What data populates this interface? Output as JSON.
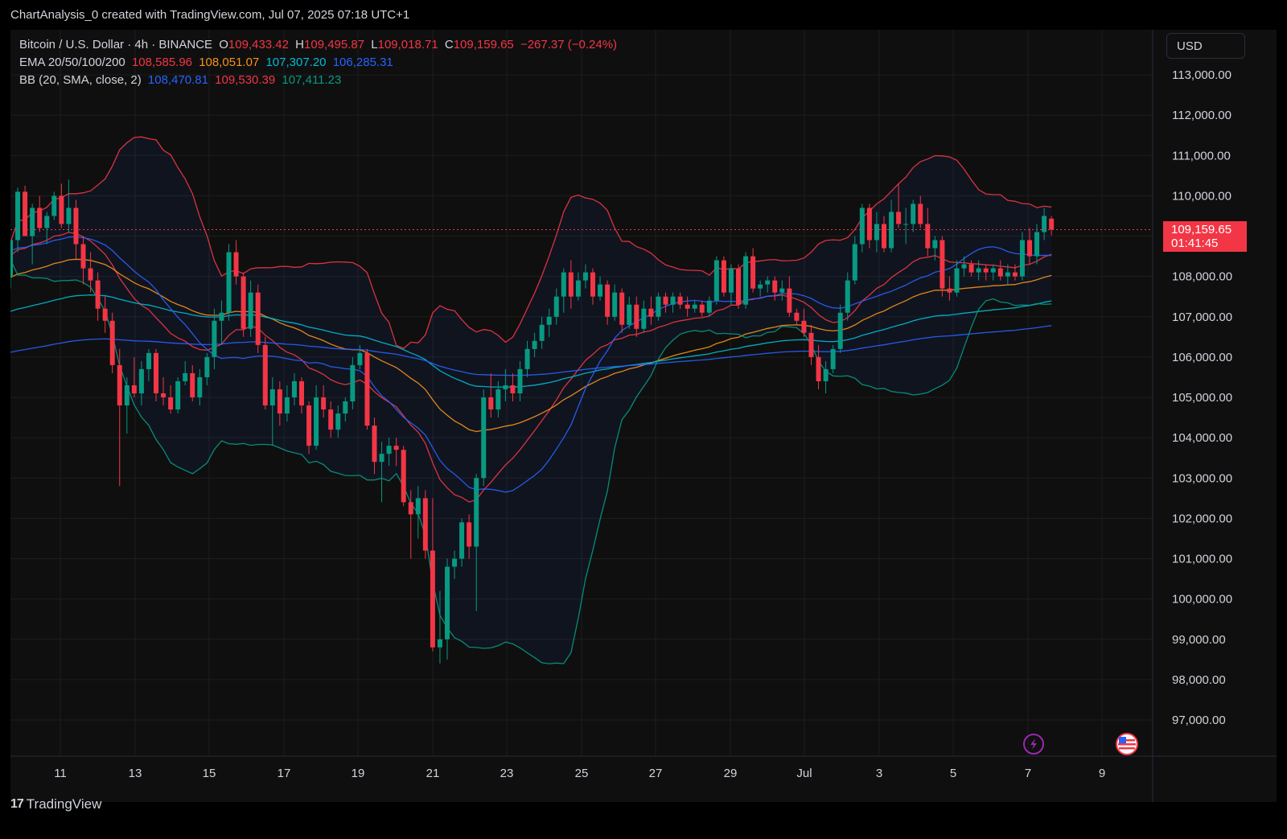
{
  "header": {
    "title": "ChartAnalysis_0 created with TradingView.com, Jul 07, 2025 07:18 UTC+1"
  },
  "legend": {
    "symbol": "Bitcoin / U.S. Dollar · 4h · BINANCE",
    "o_label": "O",
    "o": "109,433.42",
    "h_label": "H",
    "h": "109,495.87",
    "l_label": "L",
    "l": "109,018.71",
    "c_label": "C",
    "c": "109,159.65",
    "change": "−267.37 (−0.24%)",
    "ema_label": "EMA 20/50/100/200",
    "ema20": "108,585.96",
    "ema50": "108,051.07",
    "ema100": "107,307.20",
    "ema200": "106,285.31",
    "bb_label": "BB (20, SMA, close, 2)",
    "bb_basis": "108,470.81",
    "bb_upper": "109,530.39",
    "bb_lower": "107,411.23"
  },
  "currency": "USD",
  "price_tag": {
    "price": "109,159.65",
    "countdown": "01:41:45"
  },
  "footer": {
    "brand": "TradingView",
    "logo_text": "17"
  },
  "colors": {
    "up": "#089981",
    "down": "#f23645",
    "ema20": "#f23645",
    "ema50": "#f7931a",
    "ema100": "#00bcd4",
    "ema200": "#2962ff",
    "bb_basis": "#2962ff",
    "bb_upper": "#f23645",
    "bb_lower": "#089981",
    "text": "#d1d4dc",
    "grid": "#1e1e1e"
  },
  "icons": [
    "lightning-icon",
    "us-flag-icon"
  ],
  "chart_data": {
    "type": "candlestick",
    "title": "Bitcoin / U.S. Dollar · 4h · BINANCE",
    "y_ticks": [
      "113,000.00",
      "112,000.00",
      "111,000.00",
      "110,000.00",
      "108,000.00",
      "107,000.00",
      "106,000.00",
      "105,000.00",
      "104,000.00",
      "103,000.00",
      "102,000.00",
      "101,000.00",
      "100,000.00",
      "99,000.00",
      "98,000.00",
      "97,000.00"
    ],
    "x_ticks": [
      "11",
      "13",
      "15",
      "17",
      "19",
      "21",
      "23",
      "25",
      "27",
      "29",
      "Jul",
      "3",
      "5",
      "7",
      "9"
    ],
    "ylim": [
      96000,
      113500
    ],
    "candles": [
      {
        "o": 108000,
        "h": 108600,
        "l": 107700,
        "c": 108900
      },
      {
        "o": 108900,
        "h": 110200,
        "l": 108600,
        "c": 110100
      },
      {
        "o": 110100,
        "h": 110250,
        "l": 109000,
        "c": 109000
      },
      {
        "o": 109000,
        "h": 109800,
        "l": 108300,
        "c": 109700
      },
      {
        "o": 109700,
        "h": 110000,
        "l": 109100,
        "c": 109200
      },
      {
        "o": 109200,
        "h": 109600,
        "l": 108800,
        "c": 109500
      },
      {
        "o": 109500,
        "h": 110100,
        "l": 109400,
        "c": 110000
      },
      {
        "o": 110000,
        "h": 110300,
        "l": 109200,
        "c": 109300
      },
      {
        "o": 109300,
        "h": 110400,
        "l": 109100,
        "c": 109700
      },
      {
        "o": 109700,
        "h": 109900,
        "l": 108400,
        "c": 108800
      },
      {
        "o": 108800,
        "h": 109000,
        "l": 107800,
        "c": 108200
      },
      {
        "o": 108200,
        "h": 108600,
        "l": 107600,
        "c": 107900
      },
      {
        "o": 107900,
        "h": 108100,
        "l": 106900,
        "c": 107200
      },
      {
        "o": 107200,
        "h": 107500,
        "l": 106600,
        "c": 106900
      },
      {
        "o": 106900,
        "h": 107100,
        "l": 105600,
        "c": 105800
      },
      {
        "o": 105800,
        "h": 106200,
        "l": 102800,
        "c": 104800
      },
      {
        "o": 104800,
        "h": 105500,
        "l": 104100,
        "c": 105300
      },
      {
        "o": 105300,
        "h": 106000,
        "l": 105000,
        "c": 105100
      },
      {
        "o": 105100,
        "h": 105900,
        "l": 104800,
        "c": 105700
      },
      {
        "o": 105700,
        "h": 106200,
        "l": 105400,
        "c": 106100
      },
      {
        "o": 106100,
        "h": 106200,
        "l": 104900,
        "c": 105100
      },
      {
        "o": 105100,
        "h": 105500,
        "l": 104800,
        "c": 105000
      },
      {
        "o": 105000,
        "h": 105300,
        "l": 104600,
        "c": 104700
      },
      {
        "o": 104700,
        "h": 105500,
        "l": 104600,
        "c": 105400
      },
      {
        "o": 105400,
        "h": 105900,
        "l": 105300,
        "c": 105600
      },
      {
        "o": 105600,
        "h": 105800,
        "l": 104900,
        "c": 105000
      },
      {
        "o": 105000,
        "h": 105700,
        "l": 104800,
        "c": 105500
      },
      {
        "o": 105500,
        "h": 106100,
        "l": 105300,
        "c": 106000
      },
      {
        "o": 106000,
        "h": 107200,
        "l": 105700,
        "c": 106900
      },
      {
        "o": 106900,
        "h": 107400,
        "l": 106300,
        "c": 107100
      },
      {
        "o": 107100,
        "h": 108800,
        "l": 106900,
        "c": 108600
      },
      {
        "o": 108600,
        "h": 108900,
        "l": 107800,
        "c": 108000
      },
      {
        "o": 108000,
        "h": 108100,
        "l": 106500,
        "c": 106700
      },
      {
        "o": 106700,
        "h": 107900,
        "l": 106500,
        "c": 107600
      },
      {
        "o": 107600,
        "h": 107800,
        "l": 106100,
        "c": 106300
      },
      {
        "o": 106300,
        "h": 106500,
        "l": 104700,
        "c": 104800
      },
      {
        "o": 104800,
        "h": 105500,
        "l": 103800,
        "c": 105200
      },
      {
        "o": 105200,
        "h": 105400,
        "l": 104300,
        "c": 104600
      },
      {
        "o": 104600,
        "h": 105300,
        "l": 104400,
        "c": 105000
      },
      {
        "o": 105000,
        "h": 105600,
        "l": 104800,
        "c": 105400
      },
      {
        "o": 105400,
        "h": 105500,
        "l": 104600,
        "c": 104800
      },
      {
        "o": 104800,
        "h": 104900,
        "l": 103600,
        "c": 103800
      },
      {
        "o": 103800,
        "h": 105300,
        "l": 103700,
        "c": 105000
      },
      {
        "o": 105000,
        "h": 105300,
        "l": 104500,
        "c": 104700
      },
      {
        "o": 104700,
        "h": 104900,
        "l": 104000,
        "c": 104200
      },
      {
        "o": 104200,
        "h": 104800,
        "l": 104000,
        "c": 104600
      },
      {
        "o": 104600,
        "h": 105000,
        "l": 104400,
        "c": 104900
      },
      {
        "o": 104900,
        "h": 106000,
        "l": 104700,
        "c": 105800
      },
      {
        "o": 105800,
        "h": 106300,
        "l": 105700,
        "c": 106100
      },
      {
        "o": 106100,
        "h": 106200,
        "l": 104200,
        "c": 104300
      },
      {
        "o": 104300,
        "h": 104500,
        "l": 103100,
        "c": 103400
      },
      {
        "o": 103400,
        "h": 103900,
        "l": 102400,
        "c": 103600
      },
      {
        "o": 103600,
        "h": 104000,
        "l": 103300,
        "c": 103800
      },
      {
        "o": 103800,
        "h": 104000,
        "l": 103300,
        "c": 103700
      },
      {
        "o": 103700,
        "h": 103800,
        "l": 102300,
        "c": 102400
      },
      {
        "o": 102400,
        "h": 102700,
        "l": 101000,
        "c": 102100
      },
      {
        "o": 102100,
        "h": 102800,
        "l": 101500,
        "c": 102500
      },
      {
        "o": 102500,
        "h": 102700,
        "l": 101000,
        "c": 101200
      },
      {
        "o": 101200,
        "h": 102500,
        "l": 98700,
        "c": 98800
      },
      {
        "o": 98800,
        "h": 100200,
        "l": 98400,
        "c": 99000
      },
      {
        "o": 99000,
        "h": 101000,
        "l": 98500,
        "c": 100800
      },
      {
        "o": 100800,
        "h": 101200,
        "l": 100500,
        "c": 101000
      },
      {
        "o": 101000,
        "h": 102000,
        "l": 100800,
        "c": 101900
      },
      {
        "o": 101900,
        "h": 102100,
        "l": 101000,
        "c": 101300
      },
      {
        "o": 101300,
        "h": 103100,
        "l": 99700,
        "c": 103000
      },
      {
        "o": 103000,
        "h": 105200,
        "l": 102800,
        "c": 105000
      },
      {
        "o": 105000,
        "h": 105600,
        "l": 104500,
        "c": 104700
      },
      {
        "o": 104700,
        "h": 105400,
        "l": 104500,
        "c": 105200
      },
      {
        "o": 105200,
        "h": 105700,
        "l": 104900,
        "c": 105300
      },
      {
        "o": 105300,
        "h": 105600,
        "l": 104900,
        "c": 105100
      },
      {
        "o": 105100,
        "h": 105900,
        "l": 104900,
        "c": 105700
      },
      {
        "o": 105700,
        "h": 106400,
        "l": 105500,
        "c": 106200
      },
      {
        "o": 106200,
        "h": 106600,
        "l": 106000,
        "c": 106400
      },
      {
        "o": 106400,
        "h": 107000,
        "l": 106200,
        "c": 106800
      },
      {
        "o": 106800,
        "h": 107200,
        "l": 106500,
        "c": 107000
      },
      {
        "o": 107000,
        "h": 107700,
        "l": 106800,
        "c": 107500
      },
      {
        "o": 107500,
        "h": 108200,
        "l": 107100,
        "c": 108100
      },
      {
        "o": 108100,
        "h": 108400,
        "l": 107200,
        "c": 107500
      },
      {
        "o": 107500,
        "h": 108100,
        "l": 107400,
        "c": 107900
      },
      {
        "o": 107900,
        "h": 108300,
        "l": 107700,
        "c": 108100
      },
      {
        "o": 108100,
        "h": 108200,
        "l": 107300,
        "c": 107500
      },
      {
        "o": 107500,
        "h": 108000,
        "l": 107400,
        "c": 107800
      },
      {
        "o": 107800,
        "h": 107900,
        "l": 106800,
        "c": 107000
      },
      {
        "o": 107000,
        "h": 107800,
        "l": 106900,
        "c": 107600
      },
      {
        "o": 107600,
        "h": 107700,
        "l": 106600,
        "c": 106800
      },
      {
        "o": 106800,
        "h": 107500,
        "l": 106700,
        "c": 107300
      },
      {
        "o": 107300,
        "h": 107500,
        "l": 106500,
        "c": 106700
      },
      {
        "o": 106700,
        "h": 107400,
        "l": 106600,
        "c": 107200
      },
      {
        "o": 107200,
        "h": 107500,
        "l": 106800,
        "c": 107000
      },
      {
        "o": 107000,
        "h": 107600,
        "l": 106900,
        "c": 107500
      },
      {
        "o": 107500,
        "h": 107600,
        "l": 107100,
        "c": 107300
      },
      {
        "o": 107300,
        "h": 107600,
        "l": 107100,
        "c": 107500
      },
      {
        "o": 107500,
        "h": 107600,
        "l": 107200,
        "c": 107300
      },
      {
        "o": 107300,
        "h": 107500,
        "l": 107000,
        "c": 107200
      },
      {
        "o": 107200,
        "h": 107400,
        "l": 107100,
        "c": 107300
      },
      {
        "o": 107300,
        "h": 107400,
        "l": 107000,
        "c": 107100
      },
      {
        "o": 107100,
        "h": 107500,
        "l": 107000,
        "c": 107400
      },
      {
        "o": 107400,
        "h": 108500,
        "l": 107300,
        "c": 108400
      },
      {
        "o": 108400,
        "h": 108500,
        "l": 107500,
        "c": 107600
      },
      {
        "o": 107600,
        "h": 108300,
        "l": 107300,
        "c": 108200
      },
      {
        "o": 108200,
        "h": 108300,
        "l": 107200,
        "c": 107300
      },
      {
        "o": 107300,
        "h": 108600,
        "l": 107200,
        "c": 108500
      },
      {
        "o": 108500,
        "h": 108700,
        "l": 107600,
        "c": 107700
      },
      {
        "o": 107700,
        "h": 107900,
        "l": 107500,
        "c": 107800
      },
      {
        "o": 107800,
        "h": 108000,
        "l": 107600,
        "c": 107900
      },
      {
        "o": 107900,
        "h": 108000,
        "l": 107400,
        "c": 107600
      },
      {
        "o": 107600,
        "h": 107900,
        "l": 107400,
        "c": 107700
      },
      {
        "o": 107700,
        "h": 108000,
        "l": 107000,
        "c": 107100
      },
      {
        "o": 107100,
        "h": 107200,
        "l": 106800,
        "c": 106900
      },
      {
        "o": 106900,
        "h": 107200,
        "l": 106500,
        "c": 106600
      },
      {
        "o": 106600,
        "h": 106800,
        "l": 105800,
        "c": 106000
      },
      {
        "o": 106000,
        "h": 106300,
        "l": 105200,
        "c": 105400
      },
      {
        "o": 105400,
        "h": 105900,
        "l": 105100,
        "c": 105700
      },
      {
        "o": 105700,
        "h": 106300,
        "l": 105600,
        "c": 106200
      },
      {
        "o": 106200,
        "h": 107300,
        "l": 106100,
        "c": 107100
      },
      {
        "o": 107100,
        "h": 108100,
        "l": 106900,
        "c": 107900
      },
      {
        "o": 107900,
        "h": 109000,
        "l": 107800,
        "c": 108800
      },
      {
        "o": 108800,
        "h": 109800,
        "l": 108600,
        "c": 109700
      },
      {
        "o": 109700,
        "h": 109800,
        "l": 108700,
        "c": 108900
      },
      {
        "o": 108900,
        "h": 109600,
        "l": 108600,
        "c": 109300
      },
      {
        "o": 109300,
        "h": 109500,
        "l": 108600,
        "c": 108700
      },
      {
        "o": 108700,
        "h": 109900,
        "l": 108600,
        "c": 109600
      },
      {
        "o": 109600,
        "h": 110300,
        "l": 109200,
        "c": 109300
      },
      {
        "o": 109300,
        "h": 109700,
        "l": 108800,
        "c": 109300
      },
      {
        "o": 109300,
        "h": 109900,
        "l": 109100,
        "c": 109800
      },
      {
        "o": 109800,
        "h": 110000,
        "l": 109200,
        "c": 109300
      },
      {
        "o": 109300,
        "h": 109700,
        "l": 108500,
        "c": 108700
      },
      {
        "o": 108700,
        "h": 109000,
        "l": 108400,
        "c": 108900
      },
      {
        "o": 108900,
        "h": 109000,
        "l": 107500,
        "c": 107700
      },
      {
        "o": 107700,
        "h": 108000,
        "l": 107400,
        "c": 107600
      },
      {
        "o": 107600,
        "h": 108400,
        "l": 107500,
        "c": 108200
      },
      {
        "o": 108200,
        "h": 108500,
        "l": 108000,
        "c": 108300
      },
      {
        "o": 108300,
        "h": 108400,
        "l": 108000,
        "c": 108100
      },
      {
        "o": 108100,
        "h": 108400,
        "l": 107900,
        "c": 108200
      },
      {
        "o": 108200,
        "h": 108300,
        "l": 107900,
        "c": 108100
      },
      {
        "o": 108100,
        "h": 108300,
        "l": 107900,
        "c": 108200
      },
      {
        "o": 108200,
        "h": 108400,
        "l": 107900,
        "c": 108000
      },
      {
        "o": 108000,
        "h": 108300,
        "l": 107800,
        "c": 108100
      },
      {
        "o": 108100,
        "h": 108300,
        "l": 107900,
        "c": 108000
      },
      {
        "o": 108000,
        "h": 109100,
        "l": 107900,
        "c": 108900
      },
      {
        "o": 108900,
        "h": 109200,
        "l": 108300,
        "c": 108500
      },
      {
        "o": 108500,
        "h": 109300,
        "l": 108300,
        "c": 109100
      },
      {
        "o": 109100,
        "h": 109700,
        "l": 108900,
        "c": 109500
      },
      {
        "o": 109433,
        "h": 109496,
        "l": 109019,
        "c": 109160
      }
    ],
    "series_style": [
      "ema20",
      "ema50",
      "ema100",
      "ema200",
      "bb_upper",
      "bb_basis",
      "bb_lower"
    ]
  }
}
